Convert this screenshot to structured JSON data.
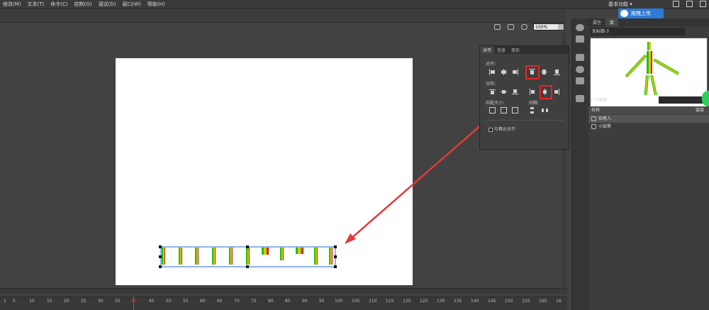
{
  "menubar": {
    "items": [
      "修改(M)",
      "文本(T)",
      "命令(C)",
      "控制(O)",
      "调试(D)",
      "窗口(W)",
      "帮助(H)"
    ],
    "workspace": "基本功能",
    "cloud_upload": "拖拽上传"
  },
  "toolbar": {
    "zoom": "100%"
  },
  "align_panel": {
    "tabs": [
      "对齐",
      "信息",
      "变形"
    ],
    "active_tab": "对齐",
    "align_label": "对齐：",
    "distribute_label": "分布：",
    "match_size_label": "匹配大小：",
    "spacing_label": "间隔：",
    "align_to_stage": "与舞台对齐",
    "highlight_color": "#e02828"
  },
  "library": {
    "tabs": [
      "属性",
      "库"
    ],
    "active_tab": "库",
    "document": "无标题-3",
    "count": "2 个项目",
    "column_name": "名称",
    "column_link": "链接",
    "items": [
      "铅笔人",
      "小铅笔"
    ]
  },
  "timeline": {
    "ticks": [
      "1",
      "5",
      "10",
      "15",
      "20",
      "25",
      "30",
      "35",
      "40",
      "45",
      "50",
      "55",
      "60",
      "65",
      "70",
      "75",
      "80",
      "85",
      "90",
      "95",
      "100",
      "105",
      "110",
      "115",
      "120",
      "125",
      "130",
      "135",
      "140",
      "145",
      "150",
      "155",
      "160",
      "16"
    ],
    "current_frame": "40"
  }
}
